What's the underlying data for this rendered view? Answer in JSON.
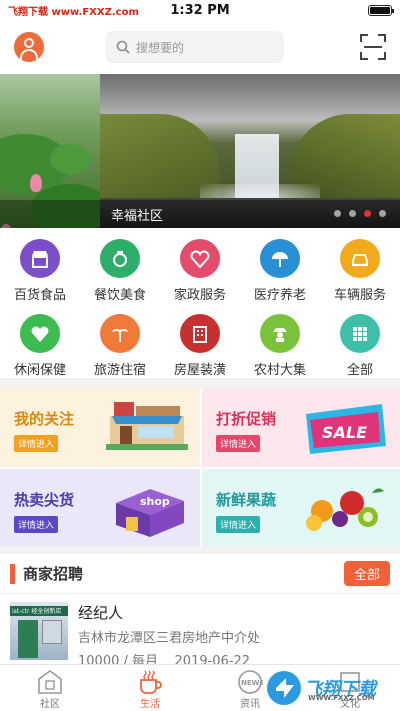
{
  "status": {
    "carrier": "飞翔下载 www.FXXZ.com",
    "time": "1:32 PM"
  },
  "header": {
    "search_placeholder": "搜想要的"
  },
  "banner": {
    "caption": "幸福社区",
    "dot_count": 4,
    "active_dot": 2
  },
  "categories": [
    {
      "label": "百货食品",
      "icon": "store-icon",
      "color": "#7b4fc9"
    },
    {
      "label": "餐饮美食",
      "icon": "dining-icon",
      "color": "#2fae6b"
    },
    {
      "label": "家政服务",
      "icon": "heart-care-icon",
      "color": "#e34c6d"
    },
    {
      "label": "医疗养老",
      "icon": "medical-umbrella-icon",
      "color": "#2b8fd6"
    },
    {
      "label": "车辆服务",
      "icon": "car-icon",
      "color": "#f2a91c"
    },
    {
      "label": "休闲保健",
      "icon": "health-heart-icon",
      "color": "#3cbb4f"
    },
    {
      "label": "旅游住宿",
      "icon": "palm-tree-icon",
      "color": "#f07a3a"
    },
    {
      "label": "房屋装潢",
      "icon": "building-icon",
      "color": "#c7302f"
    },
    {
      "label": "农村大集",
      "icon": "farmer-icon",
      "color": "#7ac23a"
    },
    {
      "label": "全部",
      "icon": "grid-icon",
      "color": "#3fbfa8"
    }
  ],
  "promos": [
    {
      "title": "我的关注",
      "tag": "详情进入",
      "art": "shop-icon"
    },
    {
      "title": "打折促销",
      "tag": "详情进入",
      "art": "sale-banner-icon",
      "art_text": "SALE"
    },
    {
      "title": "热卖尖货",
      "tag": "详情进入",
      "art": "shop-box-icon",
      "art_text": "shop"
    },
    {
      "title": "新鲜果蔬",
      "tag": "详情进入",
      "art": "fruits-icon"
    }
  ],
  "merchant": {
    "section_title": "商家招聘",
    "all_label": "全部",
    "job": {
      "title": "经纪人",
      "address": "吉林市龙潭区三君房地产中介处",
      "salary": "10000 / 每月",
      "date": "2019-06-22",
      "sign_text": "ist-ctr 经全创新店"
    }
  },
  "tabs": [
    {
      "label": "社区",
      "icon": "community-icon",
      "active": false
    },
    {
      "label": "生活",
      "icon": "coffee-icon",
      "active": true
    },
    {
      "label": "资讯",
      "icon": "news-icon",
      "active": false,
      "icon_text": "NEWS"
    },
    {
      "label": "文化",
      "icon": "culture-icon",
      "active": false
    }
  ],
  "watermark": {
    "text": "飞翔下载",
    "sub": "WWW.FXXZ.COM"
  },
  "colors": {
    "accent": "#f0623a",
    "banner_dot_active": "#e0332b"
  }
}
